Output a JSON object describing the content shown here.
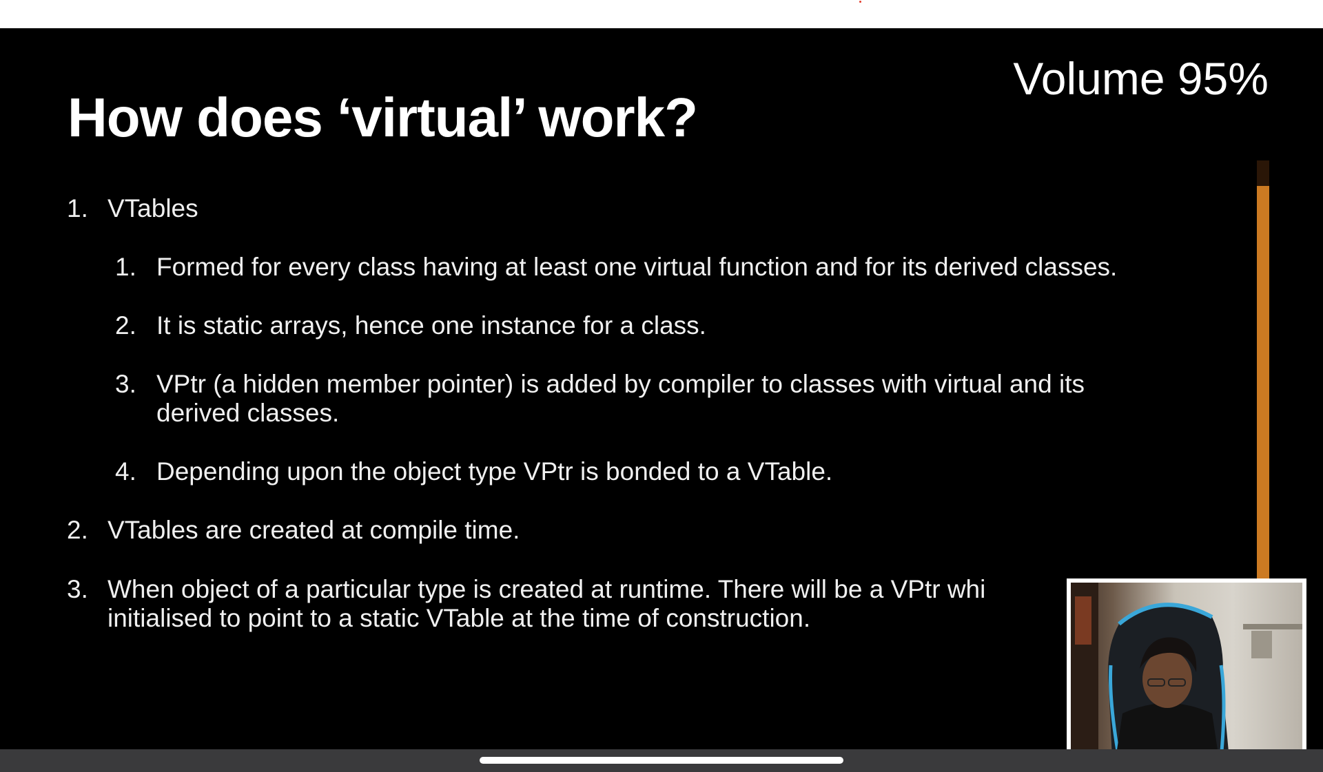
{
  "slide": {
    "title": "How does ‘virtual’ work?",
    "items": [
      {
        "number": "1.",
        "text": "VTables",
        "subitems": [
          {
            "number": "1.",
            "lines": [
              "Formed for every class having at least one virtual function and for its derived classes."
            ]
          },
          {
            "number": "2.",
            "lines": [
              "It is static arrays, hence one instance for a class."
            ]
          },
          {
            "number": "3.",
            "lines": [
              "VPtr (a hidden member pointer) is added by compiler to classes with virtual and its",
              "derived classes."
            ]
          },
          {
            "number": "4.",
            "lines": [
              "Depending upon the object type VPtr is bonded to a VTable."
            ]
          }
        ]
      },
      {
        "number": "2.",
        "text": "VTables are created at compile time."
      },
      {
        "number": "3.",
        "lines": [
          "When object of a particular type is created at runtime. There will be a VPtr whi",
          "initialised to point to a static VTable at the time of construction."
        ]
      }
    ]
  },
  "volume": {
    "label": "Volume 95%",
    "level": 0.95,
    "fill_color": "#cc7a22",
    "track_color": "#2a1607"
  },
  "webcam": {
    "description_icon": "presenter-video-feed"
  },
  "colors": {
    "background": "#000000",
    "text": "#f0f0f0",
    "title": "#ffffff"
  }
}
